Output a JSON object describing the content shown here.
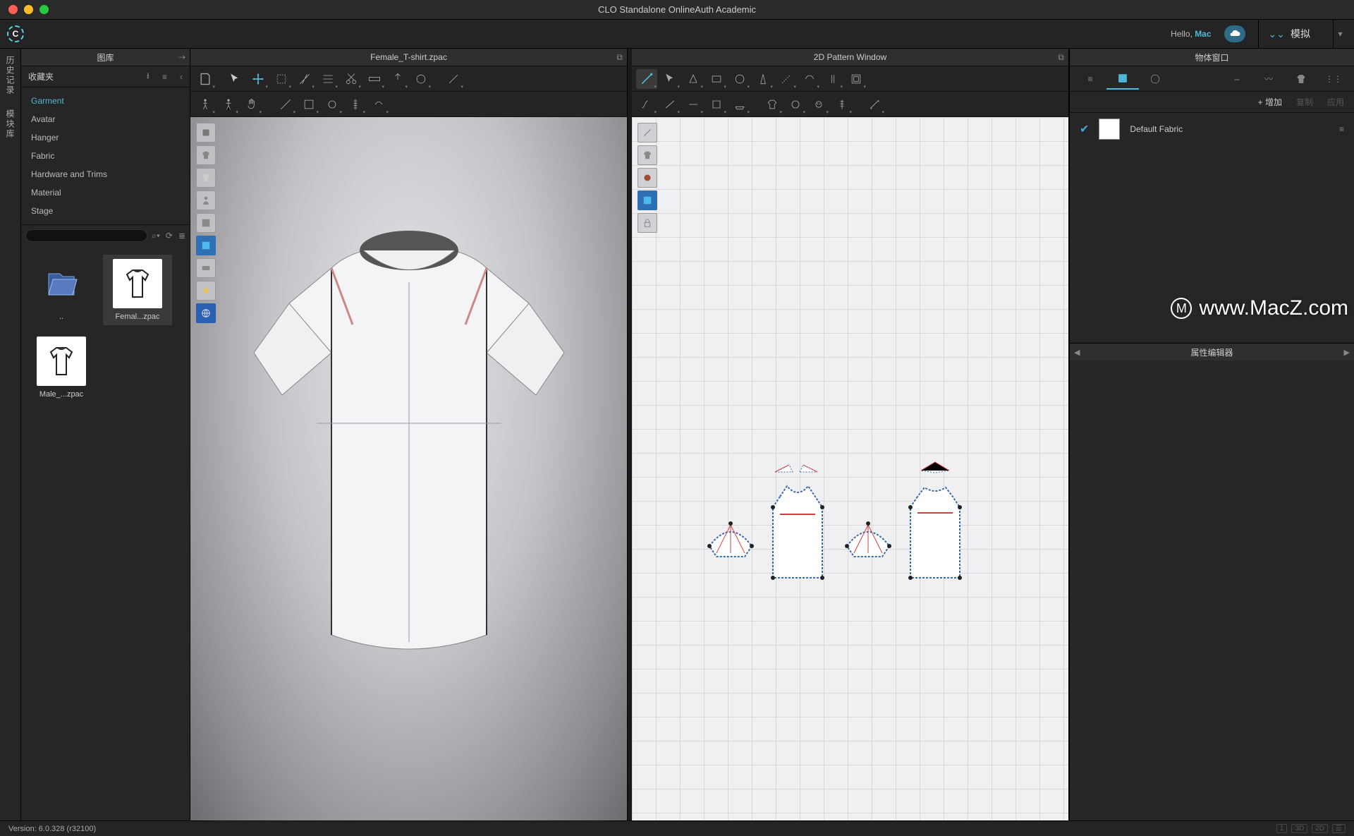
{
  "app": {
    "title": "CLO Standalone OnlineAuth Academic"
  },
  "topbar": {
    "hello_prefix": "Hello, ",
    "hello_user": "Mac",
    "sim_label": "模拟"
  },
  "rail": {
    "history": "历史记录",
    "modlib": "模块库"
  },
  "library": {
    "header": "图库",
    "favorites": "收藏夹",
    "tree": [
      {
        "label": "Garment",
        "active": true
      },
      {
        "label": "Avatar"
      },
      {
        "label": "Hanger"
      },
      {
        "label": "Fabric"
      },
      {
        "label": "Hardware and Trims"
      },
      {
        "label": "Material"
      },
      {
        "label": "Stage"
      }
    ],
    "files": [
      {
        "label": "..",
        "type": "up"
      },
      {
        "label": "Femal...zpac",
        "type": "tshirt",
        "selected": true
      },
      {
        "label": "Male_...zpac",
        "type": "tshirt"
      }
    ]
  },
  "viewport3d": {
    "header": "Female_T-shirt.zpac"
  },
  "viewport2d": {
    "header": "2D Pattern Window"
  },
  "objects": {
    "header": "物体窗口",
    "add": "+ 增加",
    "copy": "复制",
    "apply": "应用",
    "fabric_name": "Default Fabric"
  },
  "props": {
    "header": "属性编辑器"
  },
  "statusbar": {
    "version": "Version: 6.0.328 (r32100)",
    "seg1": "1",
    "seg2": "3D",
    "seg3": "2D",
    "seg4": "☰"
  },
  "watermark": {
    "logo": "M",
    "text": "www.MacZ.com"
  }
}
